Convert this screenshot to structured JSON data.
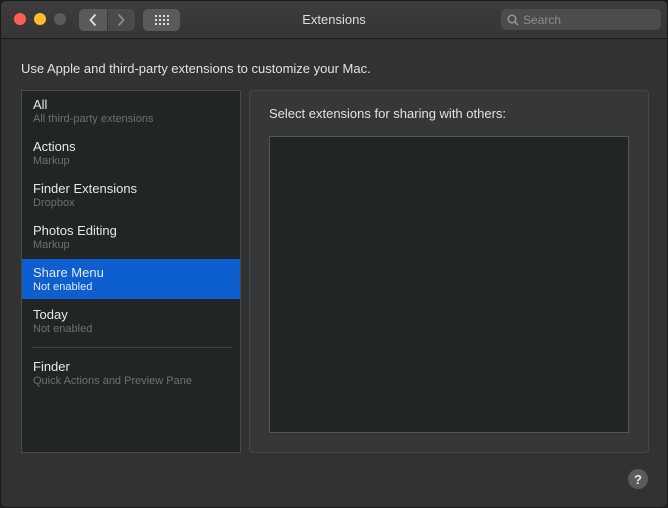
{
  "window": {
    "title": "Extensions",
    "search_placeholder": "Search"
  },
  "intro": "Use Apple and third-party extensions to customize your Mac.",
  "sidebar": {
    "items": [
      {
        "label": "All",
        "sub": "All third-party extensions",
        "selected": false
      },
      {
        "label": "Actions",
        "sub": "Markup",
        "selected": false
      },
      {
        "label": "Finder Extensions",
        "sub": "Dropbox",
        "selected": false
      },
      {
        "label": "Photos Editing",
        "sub": "Markup",
        "selected": false
      },
      {
        "label": "Share Menu",
        "sub": "Not enabled",
        "selected": true
      },
      {
        "label": "Today",
        "sub": "Not enabled",
        "selected": false
      },
      {
        "label": "Finder",
        "sub": "Quick Actions and Preview Pane",
        "selected": false
      }
    ]
  },
  "panel": {
    "heading": "Select extensions for sharing with others:"
  },
  "help": "?",
  "colors": {
    "accent": "#0d5fd0",
    "close": "#ff5f57",
    "minimize": "#febc2e"
  },
  "icons": [
    "back-icon",
    "forward-icon",
    "grid-icon",
    "search-icon",
    "help-icon"
  ]
}
